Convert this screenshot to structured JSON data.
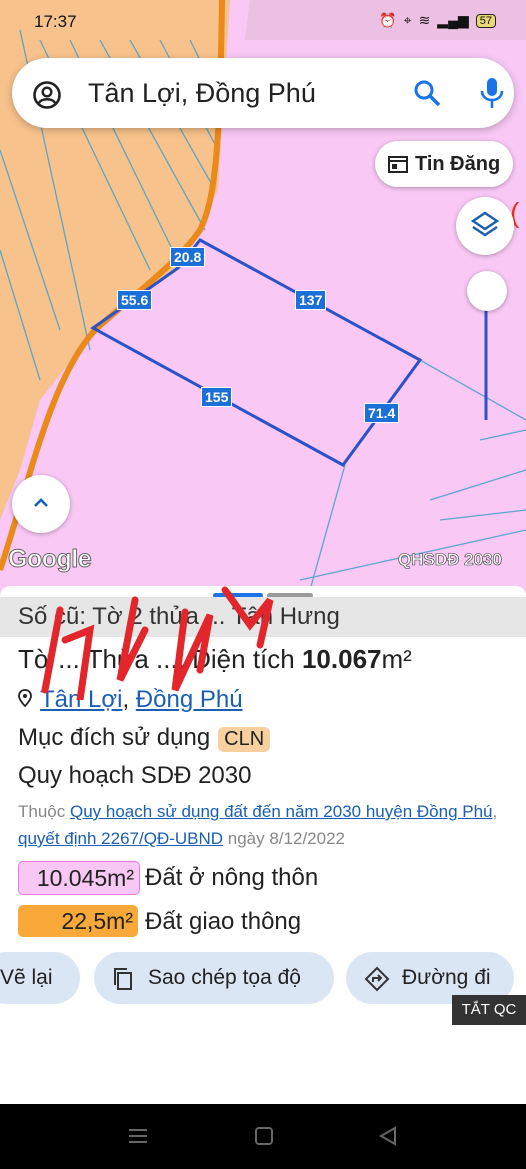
{
  "status": {
    "time": "17:37",
    "battery": "57"
  },
  "search": {
    "value": "Tân Lợi, Đồng Phú"
  },
  "map": {
    "tin_dang": "Tin Đăng",
    "google": "Google",
    "layer_name": "QHSDĐ 2030",
    "edge_labels": [
      "20.8",
      "55.6",
      "137",
      "155",
      "71.4"
    ]
  },
  "sheet": {
    "old_number": "Số cũ: Tờ 2 thửa ... Tân Hưng",
    "title_prefix": "Tờ ... Thửa ..., Diện tích ",
    "area": "10.067",
    "area_unit": "m²",
    "location_a": "Tân Lợi",
    "location_sep": ", ",
    "location_b": "Đồng Phú",
    "purpose_label": "Mục đích sử dụng",
    "purpose_code": "CLN",
    "plan_label": "Quy hoạch SDĐ 2030",
    "belongs_prefix": "Thuộc ",
    "plan_link": "Quy hoạch sử dụng đất đến năm 2030 huyện Đồng Phú",
    "decision_link": "quyết định 2267/QĐ-UBND",
    "date_text": " ngày 8/12/2022",
    "zones": [
      {
        "area": "10.045m²",
        "name": "Đất ở nông thôn",
        "color": "#f8c8f4"
      },
      {
        "area": "22,5m²",
        "name": "Đất giao thông",
        "color": "#f9a93a"
      }
    ],
    "buttons": {
      "back": "Vẽ lại",
      "copy": "Sao chép tọa độ",
      "directions": "Đường đi"
    },
    "ad_close": "TẮT QC"
  },
  "colors": {
    "accent": "#1a5fb4",
    "parcel": "#2a52c9",
    "map_bg": "#f9c8f5"
  }
}
